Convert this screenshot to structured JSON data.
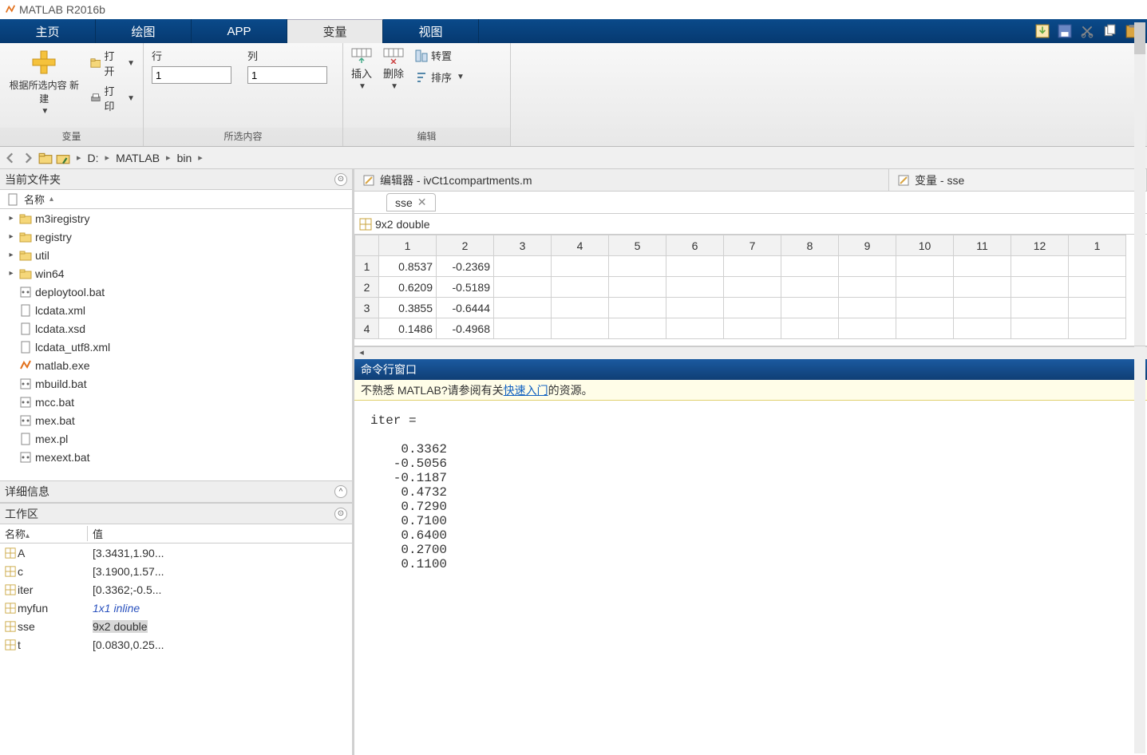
{
  "app": {
    "title": "MATLAB R2016b"
  },
  "tabs": {
    "home": "主页",
    "plots": "绘图",
    "apps": "APP",
    "variable": "变量",
    "view": "视图"
  },
  "ribbon": {
    "new_group": "根据所选内容\n新建",
    "open": "打开",
    "print": "打印",
    "row": "行",
    "col": "列",
    "row_val": "1",
    "col_val": "1",
    "insert": "插入",
    "delete": "删除",
    "transpose": "转置",
    "sort": "排序",
    "g1": "变量",
    "g2": "所选内容",
    "g3": "编辑"
  },
  "path": {
    "drive": "D:",
    "p1": "MATLAB",
    "p2": "bin"
  },
  "current_folder": {
    "title": "当前文件夹",
    "name_col": "名称",
    "items": [
      {
        "t": "folder",
        "n": "m3iregistry",
        "exp": true
      },
      {
        "t": "folder",
        "n": "registry",
        "exp": true
      },
      {
        "t": "folder",
        "n": "util",
        "exp": true
      },
      {
        "t": "folder",
        "n": "win64",
        "exp": true
      },
      {
        "t": "file",
        "n": "deploytool.bat",
        "icon": "bat"
      },
      {
        "t": "file",
        "n": "lcdata.xml",
        "icon": "xml"
      },
      {
        "t": "file",
        "n": "lcdata.xsd",
        "icon": "xml"
      },
      {
        "t": "file",
        "n": "lcdata_utf8.xml",
        "icon": "xml"
      },
      {
        "t": "file",
        "n": "matlab.exe",
        "icon": "exe"
      },
      {
        "t": "file",
        "n": "mbuild.bat",
        "icon": "bat"
      },
      {
        "t": "file",
        "n": "mcc.bat",
        "icon": "bat"
      },
      {
        "t": "file",
        "n": "mex.bat",
        "icon": "bat"
      },
      {
        "t": "file",
        "n": "mex.pl",
        "icon": "file"
      },
      {
        "t": "file",
        "n": "mexext.bat",
        "icon": "bat"
      }
    ]
  },
  "details": {
    "title": "详细信息"
  },
  "workspace": {
    "title": "工作区",
    "col_name": "名称",
    "col_value": "值",
    "rows": [
      {
        "n": "A",
        "v": "[3.3431,1.90..."
      },
      {
        "n": "c",
        "v": "[3.1900,1.57..."
      },
      {
        "n": "iter",
        "v": "[0.3362;-0.5..."
      },
      {
        "n": "myfun",
        "v": "1x1 inline",
        "inline": true
      },
      {
        "n": "sse",
        "v": "9x2 double",
        "sel": true
      },
      {
        "n": "t",
        "v": "[0.0830,0.25..."
      }
    ]
  },
  "editor": {
    "title": "编辑器 - ivCt1compartments.m"
  },
  "var_panel": {
    "title": "变量 - sse",
    "tab": "sse",
    "type": "9x2 double",
    "cols": [
      "1",
      "2",
      "3",
      "4",
      "5",
      "6",
      "7",
      "8",
      "9",
      "10",
      "11",
      "12",
      "1"
    ],
    "rows": [
      {
        "h": "1",
        "c": [
          "0.8537",
          "-0.2369"
        ]
      },
      {
        "h": "2",
        "c": [
          "0.6209",
          "-0.5189"
        ]
      },
      {
        "h": "3",
        "c": [
          "0.3855",
          "-0.6444"
        ]
      },
      {
        "h": "4",
        "c": [
          "0.1486",
          "-0.4968"
        ]
      }
    ]
  },
  "cmd": {
    "title": "命令行窗口",
    "tip_pre": "不熟悉 MATLAB?请参阅有关",
    "tip_link": "快速入门",
    "tip_post": "的资源。",
    "output": "iter =\n\n    0.3362\n   -0.5056\n   -0.1187\n    0.4732\n    0.7290\n    0.7100\n    0.6400\n    0.2700\n    0.1100"
  }
}
